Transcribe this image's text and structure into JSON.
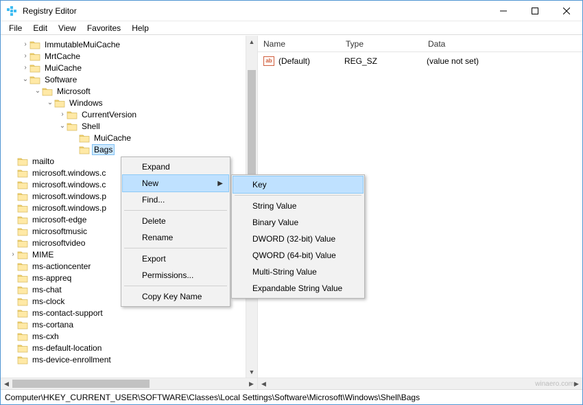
{
  "window": {
    "title": "Registry Editor"
  },
  "menu": {
    "file": "File",
    "edit": "Edit",
    "view": "View",
    "favorites": "Favorites",
    "help": "Help"
  },
  "tree": {
    "items": [
      {
        "depth": 1,
        "twisty": ">",
        "label": "ImmutableMuiCache"
      },
      {
        "depth": 1,
        "twisty": ">",
        "label": "MrtCache"
      },
      {
        "depth": 1,
        "twisty": ">",
        "label": "MuiCache"
      },
      {
        "depth": 1,
        "twisty": "v",
        "label": "Software"
      },
      {
        "depth": 2,
        "twisty": "v",
        "label": "Microsoft"
      },
      {
        "depth": 3,
        "twisty": "v",
        "label": "Windows"
      },
      {
        "depth": 4,
        "twisty": ">",
        "label": "CurrentVersion"
      },
      {
        "depth": 4,
        "twisty": "v",
        "label": "Shell"
      },
      {
        "depth": 5,
        "twisty": "",
        "label": "MuiCache"
      },
      {
        "depth": 5,
        "twisty": "",
        "label": "Bags",
        "selected": true
      },
      {
        "depth": 0,
        "twisty": "",
        "label": "mailto"
      },
      {
        "depth": 0,
        "twisty": "",
        "label": "microsoft.windows.c"
      },
      {
        "depth": 0,
        "twisty": "",
        "label": "microsoft.windows.c"
      },
      {
        "depth": 0,
        "twisty": "",
        "label": "microsoft.windows.p"
      },
      {
        "depth": 0,
        "twisty": "",
        "label": "microsoft.windows.p"
      },
      {
        "depth": 0,
        "twisty": "",
        "label": "microsoft-edge"
      },
      {
        "depth": 0,
        "twisty": "",
        "label": "microsoftmusic"
      },
      {
        "depth": 0,
        "twisty": "",
        "label": "microsoftvideo"
      },
      {
        "depth": 0,
        "twisty": ">",
        "label": "MIME"
      },
      {
        "depth": 0,
        "twisty": "",
        "label": "ms-actioncenter"
      },
      {
        "depth": 0,
        "twisty": "",
        "label": "ms-appreq"
      },
      {
        "depth": 0,
        "twisty": "",
        "label": "ms-chat"
      },
      {
        "depth": 0,
        "twisty": "",
        "label": "ms-clock"
      },
      {
        "depth": 0,
        "twisty": "",
        "label": "ms-contact-support"
      },
      {
        "depth": 0,
        "twisty": "",
        "label": "ms-cortana"
      },
      {
        "depth": 0,
        "twisty": "",
        "label": "ms-cxh"
      },
      {
        "depth": 0,
        "twisty": "",
        "label": "ms-default-location"
      },
      {
        "depth": 0,
        "twisty": "",
        "label": "ms-device-enrollment"
      }
    ]
  },
  "list": {
    "cols": {
      "name": "Name",
      "type": "Type",
      "data": "Data"
    },
    "rows": [
      {
        "name": "(Default)",
        "type": "REG_SZ",
        "data": "(value not set)"
      }
    ]
  },
  "ctxmenu": {
    "expand": "Expand",
    "new": "New",
    "find": "Find...",
    "delete": "Delete",
    "rename": "Rename",
    "export": "Export",
    "permissions": "Permissions...",
    "copykeyname": "Copy Key Name"
  },
  "submenu": {
    "key": "Key",
    "string": "String Value",
    "binary": "Binary Value",
    "dword": "DWORD (32-bit) Value",
    "qword": "QWORD (64-bit) Value",
    "multi": "Multi-String Value",
    "expand": "Expandable String Value"
  },
  "status": "Computer\\HKEY_CURRENT_USER\\SOFTWARE\\Classes\\Local Settings\\Software\\Microsoft\\Windows\\Shell\\Bags",
  "watermark": "winaero.com"
}
